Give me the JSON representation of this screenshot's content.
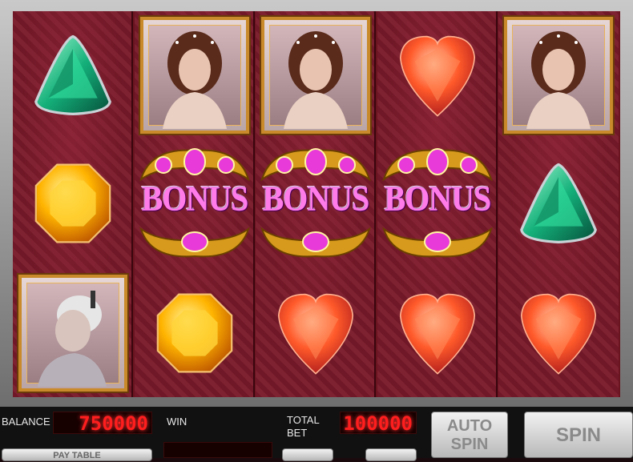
{
  "reels": [
    [
      "green-trillion-gem",
      "yellow-octagon-gem",
      "portrait-catherine"
    ],
    [
      "portrait-sisi",
      "bonus",
      "yellow-octagon-gem"
    ],
    [
      "portrait-sisi",
      "bonus",
      "red-heart-gem"
    ],
    [
      "red-heart-gem",
      "bonus",
      "red-heart-gem"
    ],
    [
      "portrait-sisi",
      "green-trillion-gem",
      "red-heart-gem"
    ]
  ],
  "bonus_label": "BONUS",
  "panel": {
    "balance_label": "BALANCE",
    "balance_value": "750000",
    "win_label": "WIN",
    "total_bet_label_1": "TOTAL",
    "total_bet_label_2": "BET",
    "total_bet_value": "100000",
    "auto_spin_1": "AUTO",
    "auto_spin_2": "SPIN",
    "spin_label": "SPIN",
    "pay_table_label": "PAY TABLE"
  },
  "colors": {
    "reel_bg": "#7a1a2a",
    "led_red": "#ff1e1e",
    "bonus_pink": "#ff7bea",
    "frame_gold": "#c88a2a"
  }
}
